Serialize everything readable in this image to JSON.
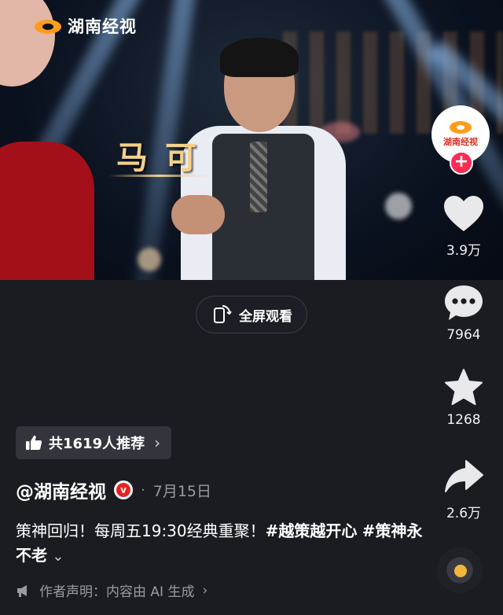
{
  "video": {
    "brand_name": "湖南经视",
    "name_caption": "马可"
  },
  "fullscreen": {
    "label": "全屏观看",
    "icon": "fullscreen-rotate-icon"
  },
  "rail": {
    "avatar_text": "湖南经视",
    "follow_symbol": "+",
    "like": {
      "icon": "heart-icon",
      "count": "3.9万"
    },
    "comment": {
      "icon": "comment-icon",
      "count": "7964"
    },
    "favorite": {
      "icon": "star-icon",
      "count": "1268"
    },
    "share": {
      "icon": "share-arrow-icon",
      "count": "2.6万"
    }
  },
  "recommend": {
    "icon": "thumbs-up-icon",
    "label": "共1619人推荐",
    "arrow": "›"
  },
  "post": {
    "author": "@湖南经视",
    "verified_mark": "v",
    "separator": "·",
    "date": "7月15日",
    "caption_text": "策神回归！每周五19:30经典重聚！",
    "hashtag_1": "#越策越开心",
    "hashtag_2": "#策神永不老",
    "expand": "⌄"
  },
  "ai_notice": {
    "icon": "megaphone-icon",
    "label": "作者声明：内容由 AI 生成",
    "arrow": "›"
  },
  "colors": {
    "background": "#1b1c22",
    "accent_red": "#fe2c55",
    "brand_orange": "#ff9c1a",
    "caption_gold": "#f4d08a"
  }
}
